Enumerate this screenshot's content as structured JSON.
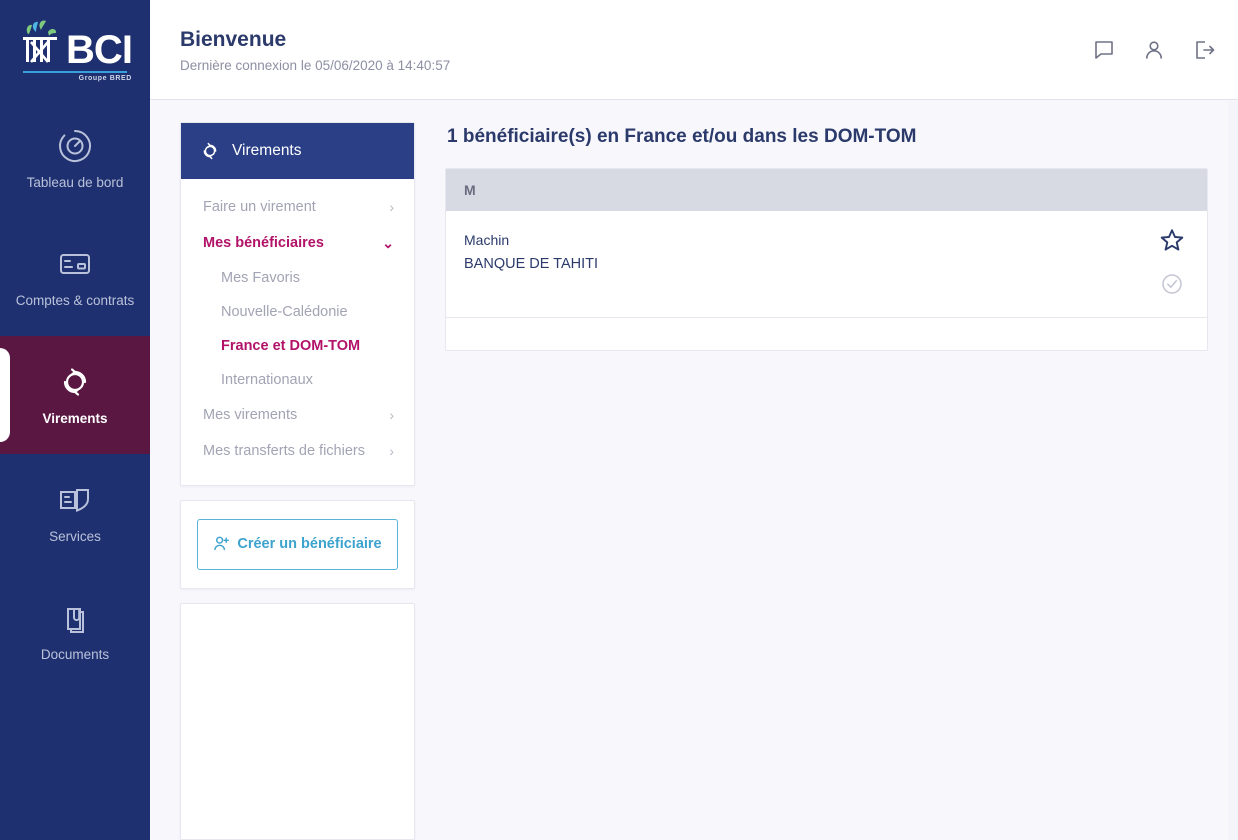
{
  "brand": {
    "name": "BCI",
    "tagline": "Groupe BRED",
    "accent_blue": "#3aa0dc",
    "rail_bg": "#1f3070",
    "active_bg": "#5a1742",
    "magenta": "#b21368",
    "navy_text": "#2b3a6b"
  },
  "rail": {
    "items": [
      {
        "label": "Tableau de bord",
        "icon": "dashboard-icon",
        "active": false
      },
      {
        "label": "Comptes & contrats",
        "icon": "card-icon",
        "active": false
      },
      {
        "label": "Virements",
        "icon": "transfer-icon",
        "active": true
      },
      {
        "label": "Services",
        "icon": "shield-card-icon",
        "active": false
      },
      {
        "label": "Documents",
        "icon": "documents-icon",
        "active": false
      }
    ]
  },
  "topbar": {
    "welcome": "Bienvenue",
    "last_login": "Dernière connexion le 05/06/2020 à 14:40:57",
    "actions": [
      {
        "name": "messages-icon",
        "title": "Messages"
      },
      {
        "name": "user-icon",
        "title": "Mon profil"
      },
      {
        "name": "logout-icon",
        "title": "Déconnexion"
      }
    ]
  },
  "menu": {
    "title": "Virements",
    "icon": "transfer-icon",
    "rows": [
      {
        "label": "Faire un virement",
        "chevron": "›",
        "state": "closed"
      },
      {
        "label": "Mes bénéficiaires",
        "chevron": "⌄",
        "state": "open"
      }
    ],
    "sub_rows": [
      {
        "label": "Mes Favoris",
        "active": false
      },
      {
        "label": "Nouvelle-Calédonie",
        "active": false
      },
      {
        "label": "France et DOM-TOM",
        "active": true
      },
      {
        "label": "Internationaux",
        "active": false
      }
    ],
    "rows_after": [
      {
        "label": "Mes virements",
        "chevron": "›",
        "state": "closed"
      },
      {
        "label": "Mes transferts de fichiers",
        "chevron": "›",
        "state": "closed"
      }
    ]
  },
  "create": {
    "label": "Créer un bénéficiaire",
    "icon": "add-user-icon"
  },
  "main": {
    "title": "1 bénéficiaire(s) en France et/ou dans les DOM-TOM",
    "table": {
      "group_header": "M",
      "rows": [
        {
          "name": "Machin",
          "bank": "BANQUE DE TAHITI",
          "favorite_icon": "star-outline-icon",
          "validated_icon": "check-circle-icon"
        }
      ]
    }
  }
}
